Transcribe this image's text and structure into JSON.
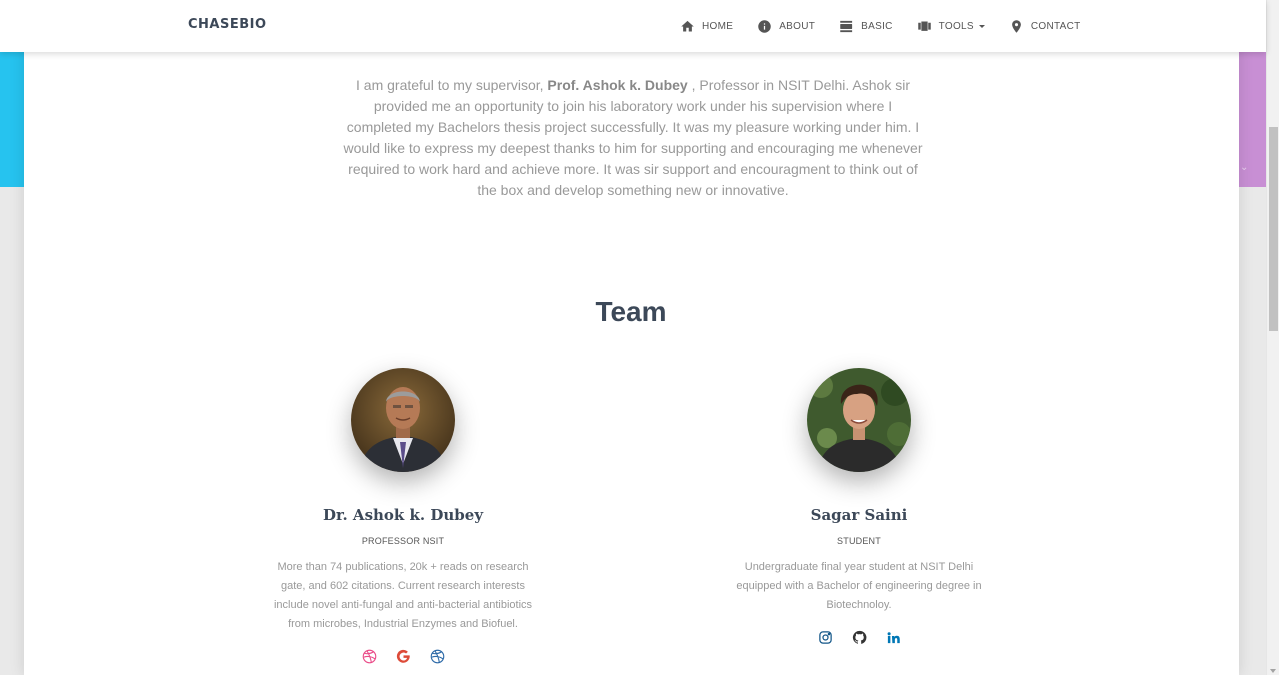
{
  "brand": "CHASEBIO",
  "nav": [
    {
      "label": "HOME",
      "icon": "home-icon"
    },
    {
      "label": "ABOUT",
      "icon": "info-icon"
    },
    {
      "label": "BASIC",
      "icon": "view-day-icon"
    },
    {
      "label": "TOOLS",
      "icon": "view-carousel-icon"
    },
    {
      "label": "CONTACT",
      "icon": "location-pin-icon"
    }
  ],
  "intro": {
    "before": "I am grateful to my supervisor, ",
    "name": "Prof. Ashok k. Dubey",
    "after": " , Professor in NSIT Delhi. Ashok sir provided me an opportunity to join his laboratory work under his supervision where I completed my Bachelors thesis project successfully. It was my pleasure working under him. I would like to express my deepest thanks to him for supporting and encouraging me whenever required to work hard and achieve more. It was sir support and encouragment to think out of the box and develop something new or innovative."
  },
  "team": {
    "title": "Team",
    "members": [
      {
        "name": "Dr. Ashok k. Dubey",
        "role": "PROFESSOR NSIT",
        "description": "More than 74 publications, 20k + reads on research gate, and 602 citations. Current research interests include novel anti-fungal and anti-bacterial antibiotics from microbes, Industrial Enzymes and Biofuel.",
        "socials": [
          "dribbble-icon",
          "google-icon",
          "dribbble-icon"
        ]
      },
      {
        "name": "Sagar Saini",
        "role": "STUDENT",
        "description": "Undergraduate final year student at NSIT Delhi equipped with a Bachelor of engineering degree in Biotechnoloy.",
        "socials": [
          "instagram-icon",
          "github-icon",
          "linkedin-icon"
        ]
      }
    ]
  },
  "colors": {
    "heading": "#3c4858",
    "muted_text": "#999999",
    "left_header_bg": "#26c3ef",
    "right_header_bg": "#c88fd4",
    "dribbble": "#ea4c89",
    "google": "#dd4b39",
    "dribbble_alt": "#2d6aa8",
    "instagram": "#125688",
    "github": "#333333",
    "linkedin": "#0077b5"
  }
}
